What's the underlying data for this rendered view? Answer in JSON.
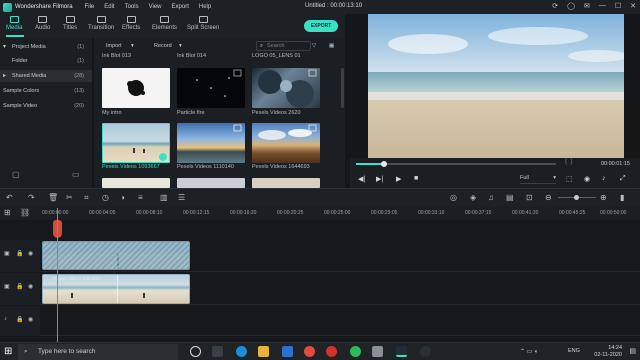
{
  "app": {
    "name": "Wondershare Filmora",
    "menu": [
      "File",
      "Edit",
      "Tools",
      "View",
      "Export",
      "Help"
    ],
    "doc_title": "Untitled : 00:00:13:10"
  },
  "toolbar": {
    "tabs": [
      "Media",
      "Audio",
      "Titles",
      "Transition",
      "Effects",
      "Elements",
      "Split Screen"
    ],
    "export_label": "EXPORT"
  },
  "left_panel": {
    "items": [
      {
        "label": "Project Media",
        "count": "(1)"
      },
      {
        "label": "Folder",
        "count": "(1)"
      },
      {
        "label": "Shared Media",
        "count": "(28)"
      },
      {
        "label": "Sample Colors",
        "count": "(13)"
      },
      {
        "label": "Sample Video",
        "count": "(20)"
      }
    ]
  },
  "media": {
    "import_label": "Import",
    "record_label": "Record",
    "search_placeholder": "Search",
    "top_labels": [
      "Ink Blot 013",
      "Ink Blot 014",
      "LOGO 05_LENS 01"
    ],
    "thumbs": [
      {
        "label": "My intro"
      },
      {
        "label": "Particle fire"
      },
      {
        "label": "Pexels Videos 2620"
      },
      {
        "label": "Pexels Videos 1093667"
      },
      {
        "label": "Pexels Videos 1110140"
      },
      {
        "label": "Pexels Videos 1644693"
      }
    ]
  },
  "preview": {
    "time": "00:00:01:15",
    "quality": "Full",
    "progress": 0.14
  },
  "ruler": {
    "ticks": [
      "00:00:00:00",
      "00:00:04:05",
      "00:00:08:10",
      "00:00:12:15",
      "00:00:16:20",
      "00:00:20:25",
      "00:00:25:00",
      "00:00:29:05",
      "00:00:33:10",
      "00:00:37:15",
      "00:00:41:20",
      "00:00:45:25",
      "00:00:50:00"
    ]
  },
  "tracks": {
    "clip_label": "Pexels Videos 1093667"
  },
  "taskbar": {
    "search_placeholder": "Type here to search",
    "lang": "ENG",
    "time": "14:24",
    "date": "02-11-2020"
  },
  "colors": {
    "accent": "#3ce0c6",
    "playhead": "#ff5a4a",
    "background": "#14161a"
  }
}
